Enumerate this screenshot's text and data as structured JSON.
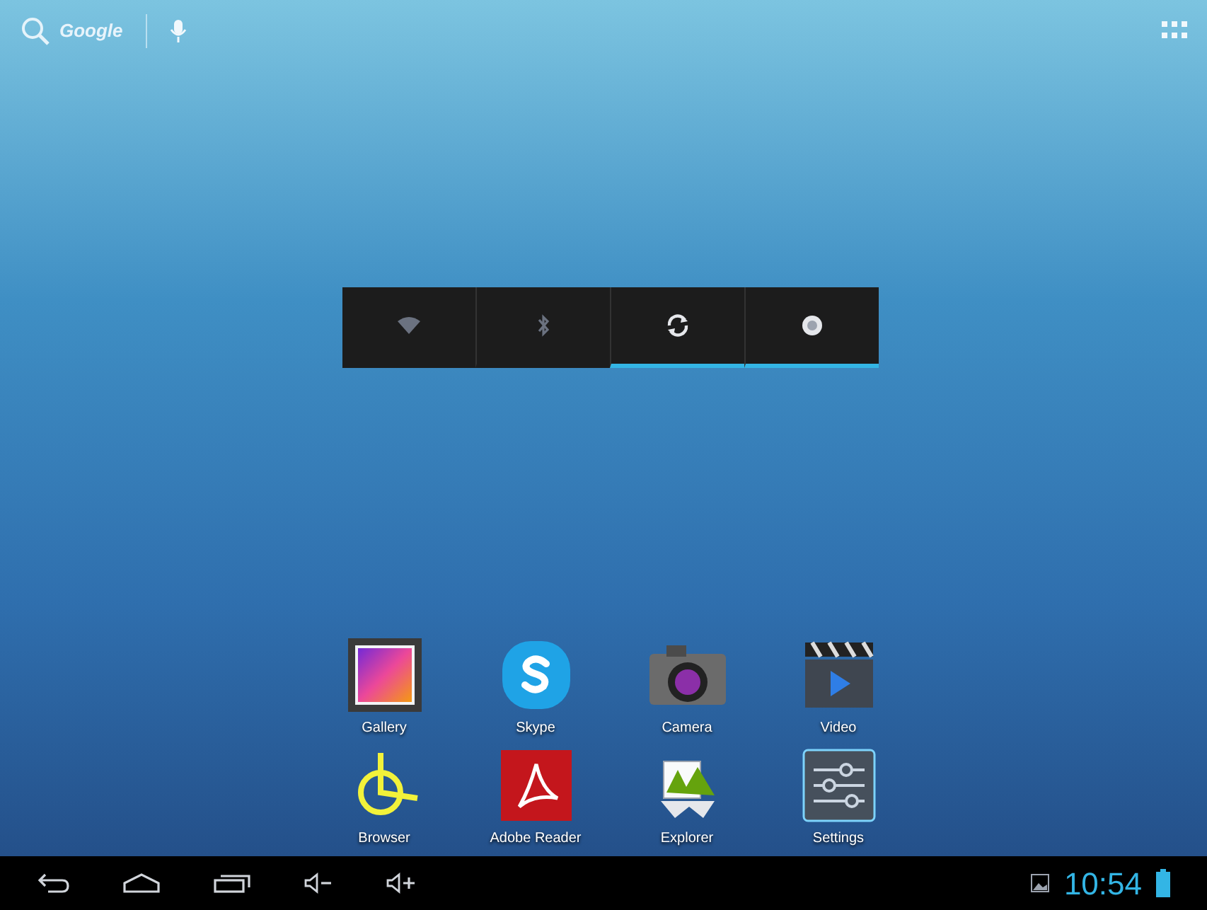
{
  "search_bar": {
    "label": "Google"
  },
  "power_widget": {
    "toggles": [
      {
        "kind": "wifi",
        "on": false
      },
      {
        "kind": "bluetooth",
        "on": false
      },
      {
        "kind": "sync",
        "on": true
      },
      {
        "kind": "brightness",
        "on": true
      }
    ]
  },
  "apps": [
    {
      "kind": "gallery",
      "label": "Gallery"
    },
    {
      "kind": "skype",
      "label": "Skype"
    },
    {
      "kind": "camera",
      "label": "Camera"
    },
    {
      "kind": "video",
      "label": "Video"
    },
    {
      "kind": "browser",
      "label": "Browser"
    },
    {
      "kind": "reader",
      "label": "Adobe Reader"
    },
    {
      "kind": "explorer",
      "label": "Explorer"
    },
    {
      "kind": "settings",
      "label": "Settings"
    }
  ],
  "nav_bar": {
    "time": "10:54"
  }
}
